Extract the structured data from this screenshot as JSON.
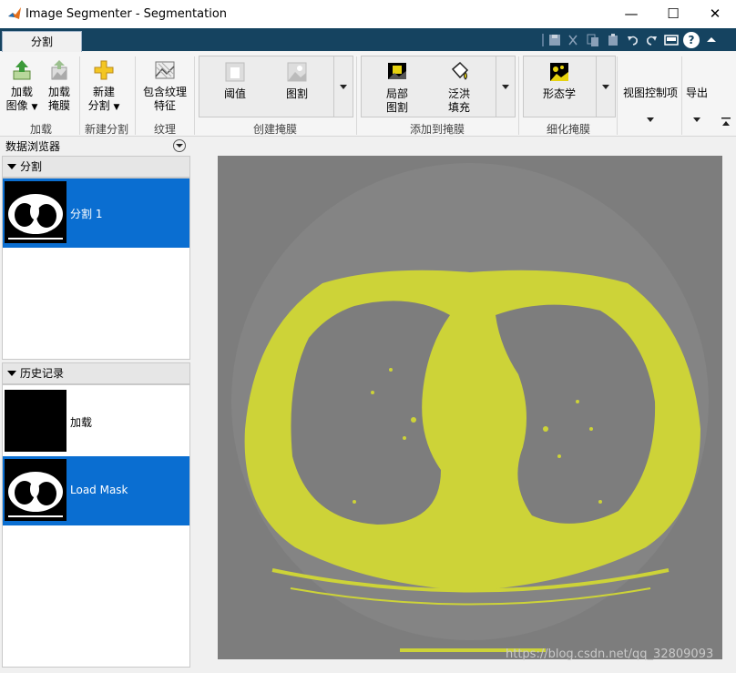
{
  "window": {
    "title": "Image Segmenter - Segmentation",
    "controls": {
      "minimize": "—",
      "maximize": "☐",
      "close": "✕"
    }
  },
  "tabs": [
    {
      "label": "分割",
      "active": true
    }
  ],
  "quick_access": {
    "help": "?"
  },
  "ribbon": {
    "groups": [
      {
        "label": "加载",
        "buttons": [
          {
            "line1": "加载",
            "line2": "图像",
            "icon": "load-image-icon",
            "dropdown": true
          },
          {
            "line1": "加载",
            "line2": "掩膜",
            "icon": "load-mask-icon"
          }
        ]
      },
      {
        "label": "新建分割",
        "buttons": [
          {
            "line1": "新建",
            "line2": "分割",
            "icon": "new-segmentation-icon",
            "dropdown": true
          }
        ]
      },
      {
        "label": "纹理",
        "buttons": [
          {
            "line1": "包含纹理",
            "line2": "特征",
            "icon": "texture-icon"
          }
        ]
      },
      {
        "label": "创建掩膜",
        "buttons": [
          {
            "line1": "阈值",
            "icon": "threshold-icon"
          },
          {
            "line1": "图割",
            "icon": "graph-cut-icon"
          }
        ]
      },
      {
        "label": "添加到掩膜",
        "buttons": [
          {
            "line1": "局部",
            "line2": "图割",
            "icon": "local-graph-cut-icon"
          },
          {
            "line1": "泛洪",
            "line2": "填充",
            "icon": "flood-fill-icon"
          }
        ]
      },
      {
        "label": "细化掩膜",
        "buttons": [
          {
            "line1": "形态学",
            "icon": "morphology-icon"
          }
        ]
      }
    ],
    "view_controls": "视图控制项",
    "export": "导出"
  },
  "data_browser": {
    "title": "数据浏览器",
    "segmentations": {
      "header": "分割",
      "items": [
        {
          "label": "分割 1",
          "selected": true
        }
      ]
    },
    "history": {
      "header": "历史记录",
      "items": [
        {
          "label": "加载",
          "selected": false
        },
        {
          "label": "Load Mask",
          "selected": true
        }
      ]
    }
  },
  "watermark": "https://blog.csdn.net/qq_32809093",
  "colors": {
    "ribbon_bar": "#154360",
    "selection": "#0a6ed1",
    "mask": "#cdd338",
    "background_gray": "#7d7d7d"
  }
}
